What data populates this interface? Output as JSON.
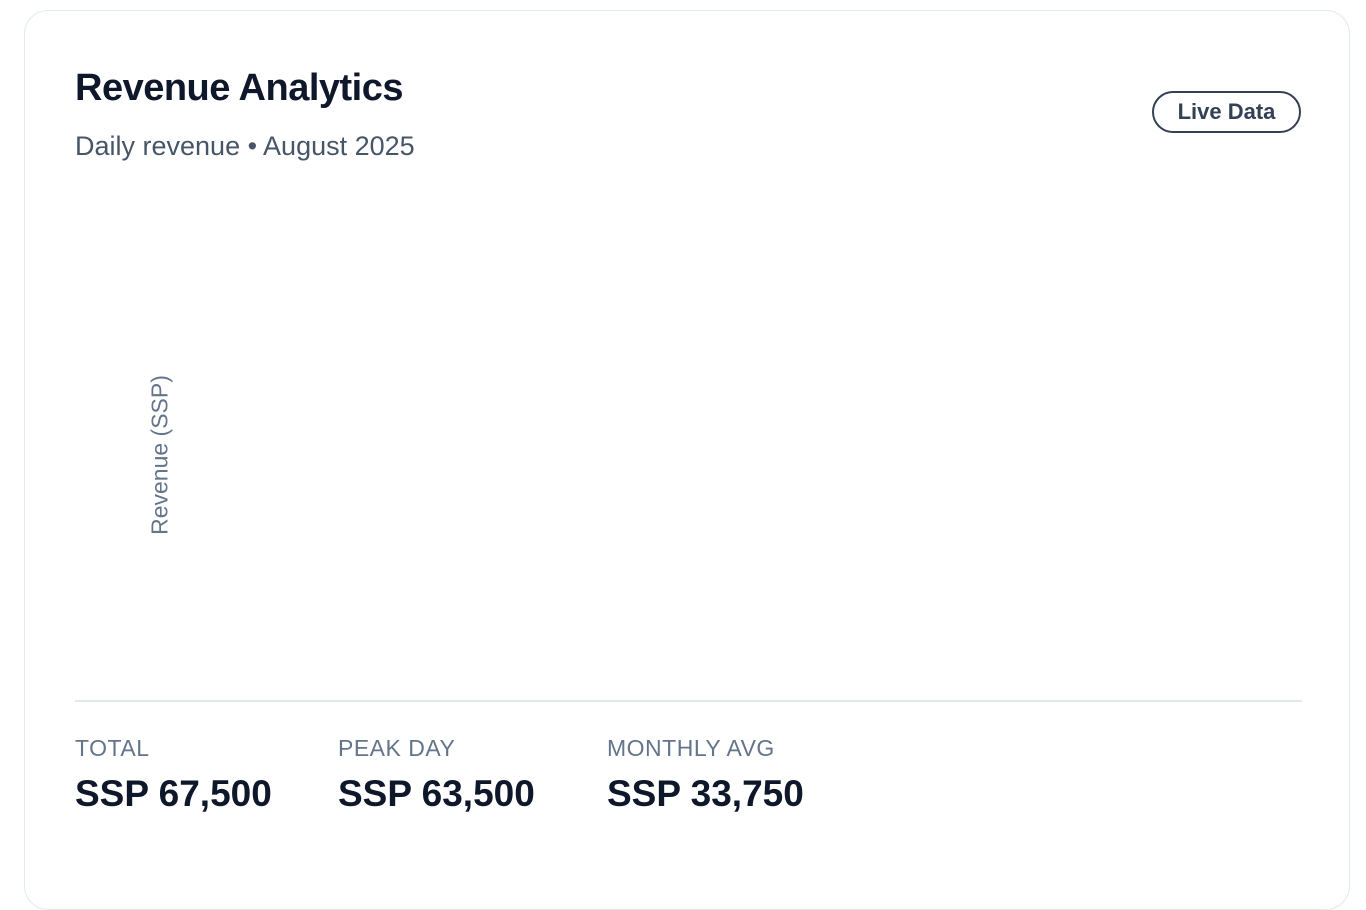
{
  "header": {
    "title": "Revenue Analytics",
    "subtitle": "Daily revenue • August 2025",
    "badge": "Live Data"
  },
  "chart_data": {
    "type": "bar",
    "title": "",
    "xlabel": "",
    "ylabel": "Revenue (SSP)",
    "categories": [],
    "values": []
  },
  "stats": [
    {
      "label": "TOTAL",
      "value": "SSP 67,500"
    },
    {
      "label": "PEAK DAY",
      "value": "SSP 63,500"
    },
    {
      "label": "MONTHLY AVG",
      "value": "SSP 33,750"
    }
  ]
}
